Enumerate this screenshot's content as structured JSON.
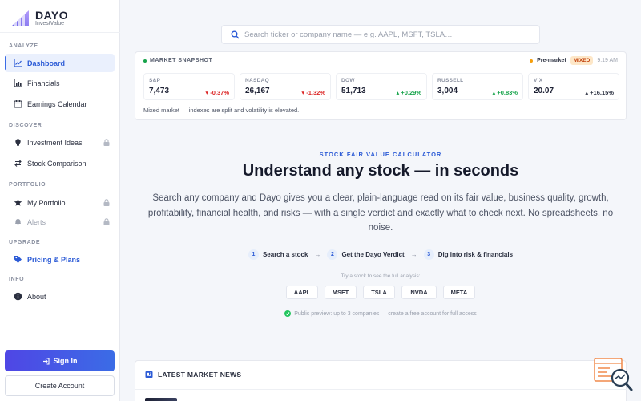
{
  "brand": {
    "name": "DAYO",
    "subtitle": "InvestValue"
  },
  "sidebar": {
    "sections": {
      "analyze": "ANALYZE",
      "discover": "DISCOVER",
      "portfolio": "PORTFOLIO",
      "upgrade": "UPGRADE",
      "info": "INFO"
    },
    "items": {
      "dashboard": "Dashboard",
      "financials": "Financials",
      "earnings_calendar": "Earnings Calendar",
      "investment_ideas": "Investment Ideas",
      "stock_comparison": "Stock Comparison",
      "my_portfolio": "My Portfolio",
      "alerts": "Alerts",
      "pricing": "Pricing & Plans",
      "about": "About"
    },
    "sign_in": "Sign In",
    "create_account": "Create Account"
  },
  "search": {
    "placeholder": "Search ticker or company name — e.g. AAPL, MSFT, TSLA…"
  },
  "snapshot": {
    "title": "MARKET SNAPSHOT",
    "session": "Pre-market",
    "badge": "MIXED",
    "time": "9:19 AM",
    "indices": [
      {
        "name": "S&P",
        "value": "7,473",
        "change": "-0.37%",
        "direction": "down"
      },
      {
        "name": "NASDAQ",
        "value": "26,167",
        "change": "-1.32%",
        "direction": "down"
      },
      {
        "name": "DOW",
        "value": "51,713",
        "change": "+0.29%",
        "direction": "up"
      },
      {
        "name": "RUSSELL",
        "value": "3,004",
        "change": "+0.83%",
        "direction": "up"
      },
      {
        "name": "VIX",
        "value": "20.07",
        "change": "+16.15%",
        "direction": "up"
      }
    ],
    "note": "Mixed market — indexes are split and volatility is elevated."
  },
  "hero": {
    "eyebrow": "STOCK FAIR VALUE CALCULATOR",
    "headline": "Understand any stock — in seconds",
    "description": "Search any company and Dayo gives you a clear, plain-language read on its fair value, business quality, growth, profitability, financial health, and risks — with a single verdict and exactly what to check next. No spreadsheets, no noise.",
    "steps": [
      {
        "num": "1",
        "label": "Search a stock"
      },
      {
        "num": "2",
        "label": "Get the Dayo Verdict"
      },
      {
        "num": "3",
        "label": "Dig into risk & financials"
      }
    ],
    "try_label": "Try a stock to see the full analysis:",
    "tickers": [
      "AAPL",
      "MSFT",
      "TSLA",
      "NVDA",
      "META"
    ],
    "notice": "Public preview: up to 3 companies — create a free account for full access"
  },
  "news": {
    "title": "LATEST MARKET NEWS"
  },
  "colors": {
    "accent": "#2c5bd6",
    "up": "#16a34a",
    "down": "#dc2626",
    "badge_bg": "#fde7c8"
  }
}
